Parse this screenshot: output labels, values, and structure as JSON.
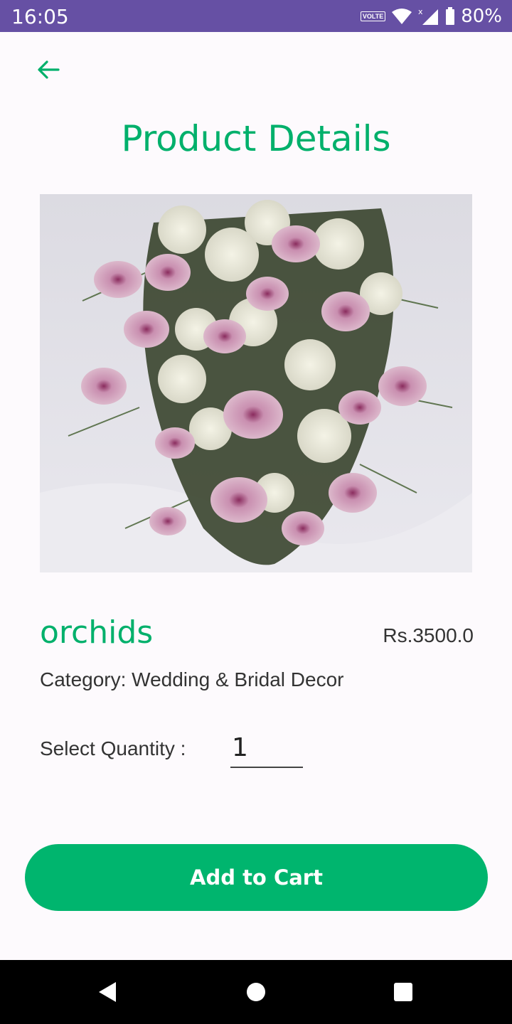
{
  "status_bar": {
    "time": "16:05",
    "network_badge": "VOLTE",
    "battery": "80%"
  },
  "header": {
    "title": "Product Details"
  },
  "product": {
    "image_icon": "flower-bouquet-image",
    "name": "orchids",
    "price": "Rs.3500.0",
    "category": "Category: Wedding & Bridal Decor"
  },
  "quantity": {
    "label": "Select Quantity :",
    "value": "1"
  },
  "actions": {
    "add_to_cart": "Add to Cart"
  },
  "colors": {
    "accent": "#00b06b",
    "status_bar": "#6650a4",
    "button": "#00b56e"
  }
}
